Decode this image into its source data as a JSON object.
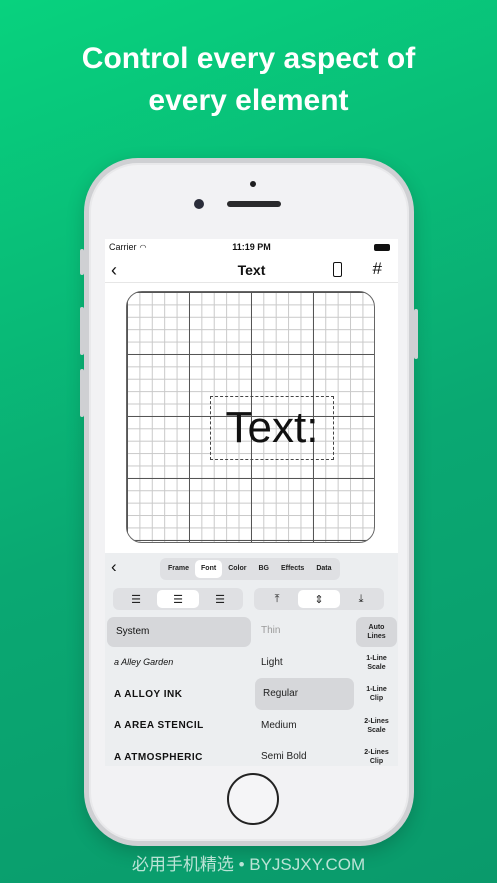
{
  "headline": {
    "line1": "Control every aspect of",
    "line2": "every element"
  },
  "status": {
    "carrier": "Carrier",
    "time": "11:19 PM"
  },
  "navbar": {
    "back": "‹",
    "title": "Text",
    "grid": "#"
  },
  "canvas": {
    "text": "Text:"
  },
  "panel": {
    "back": "‹",
    "tabs": [
      {
        "label": "Frame",
        "active": false
      },
      {
        "label": "Font",
        "active": true
      },
      {
        "label": "Color",
        "active": false
      },
      {
        "label": "BG",
        "active": false
      },
      {
        "label": "Effects",
        "active": false
      },
      {
        "label": "Data",
        "active": false
      }
    ],
    "horizontal_align": {
      "selected": "center"
    },
    "vertical_align": {
      "selected": "middle"
    },
    "fonts": [
      {
        "label": "System",
        "selected": true,
        "style": "normal"
      },
      {
        "label": "a Alley Garden",
        "selected": false,
        "style": "script"
      },
      {
        "label": "A ALLOY INK",
        "selected": false,
        "style": "bold"
      },
      {
        "label": "A AREA STENCIL",
        "selected": false,
        "style": "bold"
      },
      {
        "label": "A ATMOSPHERIC",
        "selected": false,
        "style": "bold"
      }
    ],
    "weights": [
      {
        "label": "Thin",
        "selected": false
      },
      {
        "label": "Light",
        "selected": false
      },
      {
        "label": "Regular",
        "selected": true
      },
      {
        "label": "Medium",
        "selected": false
      },
      {
        "label": "Semi Bold",
        "selected": false
      }
    ],
    "line_modes": [
      {
        "line1": "Auto",
        "line2": "Lines",
        "selected": true
      },
      {
        "line1": "1-Line",
        "line2": "Scale",
        "selected": false
      },
      {
        "line1": "1-Line",
        "line2": "Clip",
        "selected": false
      },
      {
        "line1": "2-Lines",
        "line2": "Scale",
        "selected": false
      },
      {
        "line1": "2-Lines",
        "line2": "Clip",
        "selected": false
      }
    ]
  },
  "footer": {
    "text": "必用手机精选 • BYJSJXY.COM"
  },
  "colors": {
    "background_top": "#08d27e",
    "background_bottom": "#0a9a6b",
    "panel": "#eceef0"
  }
}
